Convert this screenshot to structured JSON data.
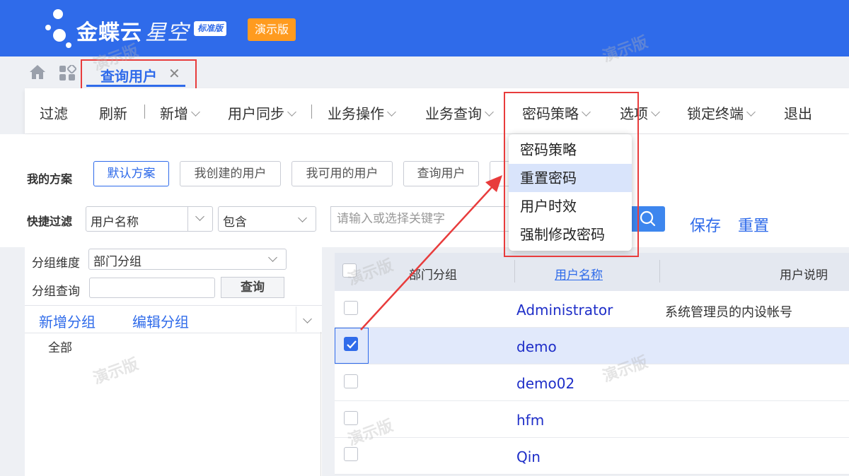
{
  "header": {
    "brand_main": "金蝶云",
    "brand_sub": "星空",
    "edition": "标准版",
    "demo_badge": "演示版"
  },
  "tabs": [
    {
      "label": "查询用户",
      "close": "✕"
    }
  ],
  "toolbar": {
    "items": [
      "过滤",
      "刷新",
      "新增",
      "用户同步",
      "业务操作",
      "业务查询",
      "密码策略",
      "选项",
      "锁定终端",
      "退出"
    ]
  },
  "password_menu": {
    "items": [
      "密码策略",
      "重置密码",
      "用户时效",
      "强制修改密码"
    ],
    "active_index": 1
  },
  "plans": {
    "label": "我的方案",
    "items": [
      "默认方案",
      "我创建的用户",
      "我可用的用户",
      "查询用户"
    ],
    "selected": "默认方案"
  },
  "quick_filter": {
    "label": "快捷过滤",
    "field": "用户名称",
    "operator": "包含",
    "placeholder": "请输入或选择关键字",
    "save": "保存",
    "reset": "重置"
  },
  "group_panel": {
    "dimension_label": "分组维度",
    "dimension_value": "部门分组",
    "search_label": "分组查询",
    "query_button": "查询",
    "add_group": "新增分组",
    "edit_group": "编辑分组",
    "tree_root": "全部"
  },
  "grid": {
    "headers": [
      "部门分组",
      "用户名称",
      "用户说明"
    ],
    "rows": [
      {
        "name": "Administrator",
        "desc": "系统管理员的内设帐号",
        "checked": false
      },
      {
        "name": "demo",
        "desc": "",
        "checked": true
      },
      {
        "name": "demo02",
        "desc": "",
        "checked": false
      },
      {
        "name": "hfm",
        "desc": "",
        "checked": false
      },
      {
        "name": "Qin",
        "desc": "",
        "checked": false
      }
    ]
  },
  "watermark": "演示版",
  "colors": {
    "brand": "#2f6bea",
    "demo_badge": "#ff9b1f",
    "annotation": "#e83c3c",
    "link": "#1e2ec8"
  }
}
